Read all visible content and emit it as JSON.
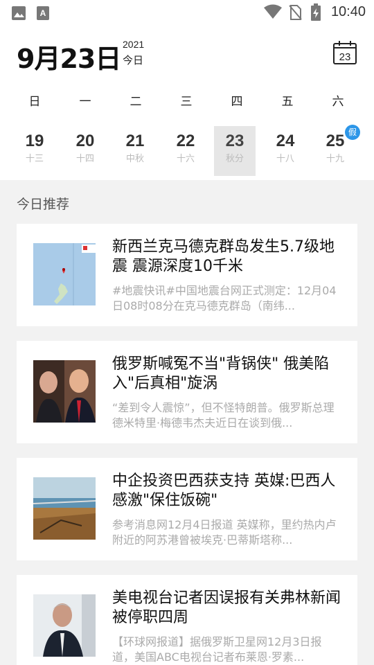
{
  "status_bar": {
    "time": "10:40",
    "icons": [
      "image-icon",
      "a-icon",
      "wifi-icon",
      "no-sim-icon",
      "battery-charging-icon"
    ]
  },
  "header": {
    "date": "9月23日",
    "year": "2021",
    "today": "今日",
    "calendar_day": "23"
  },
  "weekdays": [
    "日",
    "一",
    "二",
    "三",
    "四",
    "五",
    "六"
  ],
  "days": [
    {
      "num": "19",
      "lunar": "十三"
    },
    {
      "num": "20",
      "lunar": "十四"
    },
    {
      "num": "21",
      "lunar": "中秋"
    },
    {
      "num": "22",
      "lunar": "十六"
    },
    {
      "num": "23",
      "lunar": "秋分",
      "selected": true
    },
    {
      "num": "24",
      "lunar": "十八"
    },
    {
      "num": "25",
      "lunar": "十九",
      "badge": "假"
    }
  ],
  "section_title": "今日推荐",
  "articles": [
    {
      "title": "新西兰克马德克群岛发生5.7级地震 震源深度10千米",
      "summary": "#地震快讯#中国地震台网正式测定：12月04日08时08分在克马德克群岛（南纬...",
      "thumb": "map"
    },
    {
      "title": "俄罗斯喊冤不当\"背锅侠\" 俄美陷入\"后真相\"旋涡",
      "summary": "“差到令人震惊”，但不怪特朗普。俄罗斯总理德米特里·梅德韦杰夫近日在谈到俄...",
      "thumb": "people"
    },
    {
      "title": "中企投资巴西获支持 英媒:巴西人感激\"保住饭碗\"",
      "summary": "参考消息网12月4日报道 英媒称，里约热内卢附近的阿苏港曾被埃克·巴蒂斯塔称...",
      "thumb": "port"
    },
    {
      "title": "美电视台记者因误报有关弗林新闻被停职四周",
      "summary": "【环球网报道】据俄罗斯卫星网12月3日报道，美国ABC电视台记者布莱恩·罗素...",
      "thumb": "man"
    }
  ]
}
